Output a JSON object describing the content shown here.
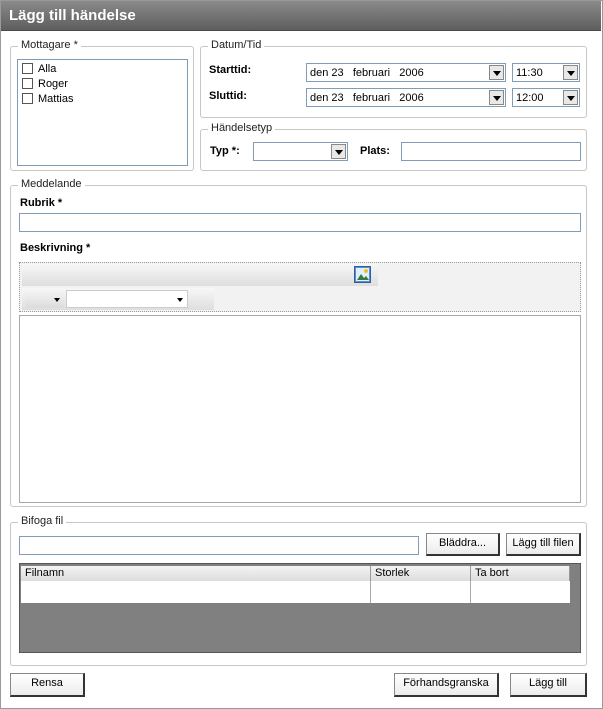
{
  "title": "Lägg till händelse",
  "recipients": {
    "legend": "Mottagare *",
    "items": [
      {
        "label": "Alla"
      },
      {
        "label": "Roger"
      },
      {
        "label": "Mattias"
      }
    ]
  },
  "datetime": {
    "legend": "Datum/Tid",
    "start_label": "Starttid:",
    "start_date": "den 23   februari   2006",
    "start_time": "11:30",
    "end_label": "Sluttid:",
    "end_date": "den 23   februari   2006",
    "end_time": "12:00"
  },
  "event_type": {
    "legend": "Händelsetyp",
    "type_label": "Typ *:",
    "type_value": "",
    "place_label": "Plats:",
    "place_value": ""
  },
  "message": {
    "legend": "Meddelande",
    "subject_label": "Rubrik *",
    "subject_value": "",
    "description_label": "Beskrivning *",
    "description_value": "",
    "toolbar": {
      "image_icon": "insert-image-icon",
      "style_dropdown_value": "",
      "font_dropdown_value": ""
    }
  },
  "attach": {
    "legend": "Bifoga fil",
    "file_path": "",
    "browse_label": "Bläddra...",
    "add_file_label": "Lägg till filen",
    "columns": [
      "Filnamn",
      "Storlek",
      "Ta bort"
    ]
  },
  "footer": {
    "reset_label": "Rensa",
    "preview_label": "Förhandsgranska",
    "add_label": "Lägg till"
  }
}
